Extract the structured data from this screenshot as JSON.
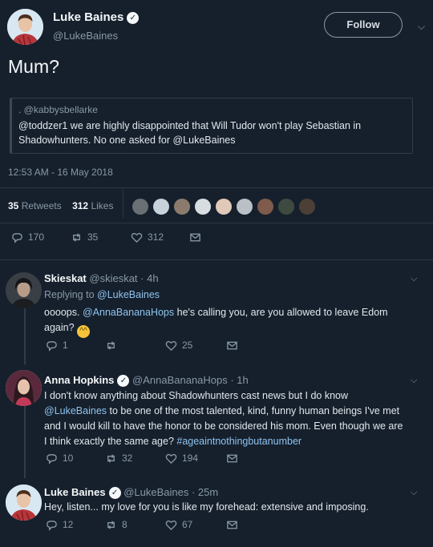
{
  "tweet": {
    "author_name": "Luke Baines",
    "author_handle": "@LukeBaines",
    "follow_label": "Follow",
    "text": "Mum?",
    "quote": {
      "handle": ". @kabbysbellarke",
      "text": "@toddzer1 we are highly disappointed that Will Tudor won't play Sebastian in Shadowhunters. No one asked for @LukeBaines"
    },
    "timestamp": "12:53 AM - 16 May 2018",
    "retweets_count": "35",
    "retweets_label": "Retweets",
    "likes_count": "312",
    "likes_label": "Likes",
    "actions": {
      "replies": "170",
      "retweets": "35",
      "likes": "312"
    }
  },
  "replies": [
    {
      "name": "Skieskat",
      "handle_time": "@skieskat · 4h",
      "replying_prefix": "Replying to ",
      "replying_to": "@LukeBaines",
      "text_pre": "oooops. ",
      "mention": "@AnnaBananaHops",
      "text_post": " he's calling you, are you allowed to leave Edom again?",
      "actions": {
        "replies": "1",
        "retweets": "",
        "likes": "25"
      }
    },
    {
      "name": "Anna Hopkins",
      "handle_time": "@AnnaBananaHops · 1h",
      "text_line1": "I don't know anything about Shadowhunters cast news but I do know",
      "mention": "@LukeBaines",
      "text_line2_post": " to be one of the most talented, kind, funny human beings I've met",
      "text_line3": "and I would kill to have the honor to be considered his mom. Even though we are",
      "text_line4_pre": "I think exactly the same age? ",
      "hashtag": "#ageaintnothingbutanumber",
      "actions": {
        "replies": "10",
        "retweets": "32",
        "likes": "194"
      }
    },
    {
      "name": "Luke Baines",
      "handle_time": "@LukeBaines · 25m",
      "text": "Hey, listen... my love for you is like my forehead: extensive and imposing.",
      "actions": {
        "replies": "12",
        "retweets": "8",
        "likes": "67"
      }
    }
  ],
  "colors": {
    "background": "#16202c",
    "link": "#8ec3f0",
    "muted": "#8899a6"
  }
}
